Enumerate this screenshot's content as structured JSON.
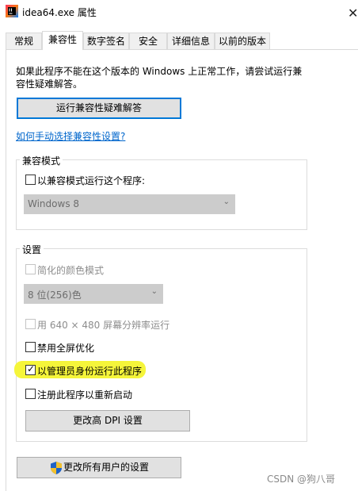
{
  "window": {
    "title": "idea64.exe 属性",
    "close_glyph": "✕"
  },
  "tabs": [
    {
      "label": "常规",
      "active": false
    },
    {
      "label": "兼容性",
      "active": true
    },
    {
      "label": "数字签名",
      "active": false
    },
    {
      "label": "安全",
      "active": false
    },
    {
      "label": "详细信息",
      "active": false
    },
    {
      "label": "以前的版本",
      "active": false
    }
  ],
  "compat": {
    "intro_line1": "如果此程序不能在这个版本的 Windows 上正常工作，请尝试运行兼",
    "intro_line2": "容性疑难解答。",
    "troubleshooter_button": "运行兼容性疑难解答",
    "manual_link": "如何手动选择兼容性设置?",
    "mode_group": {
      "title": "兼容模式",
      "checkbox_label": "以兼容模式运行这个程序:",
      "checked": false,
      "dropdown_value": "Windows 8"
    },
    "settings_group": {
      "title": "设置",
      "reduced_color_label": "简化的颜色模式",
      "color_dropdown_value": "8 位(256)色",
      "res_640_label": "用 640 × 480 屏幕分辨率运行",
      "disable_fullscreen_label": "禁用全屏优化",
      "run_as_admin_label": "以管理员身份运行此程序",
      "run_as_admin_checked": true,
      "register_restart_label": "注册此程序以重新启动",
      "dpi_button": "更改高 DPI 设置"
    },
    "all_users_button": "更改所有用户的设置"
  },
  "watermark": "CSDN @狗八哥",
  "colors": {
    "highlight": "#f5f53a",
    "link": "#0066cc",
    "focus_border": "#0078d7"
  },
  "icons": {
    "app": "intellij-idea-icon",
    "shield": "uac-shield-icon",
    "check": "✓",
    "chevron": "⌄"
  }
}
